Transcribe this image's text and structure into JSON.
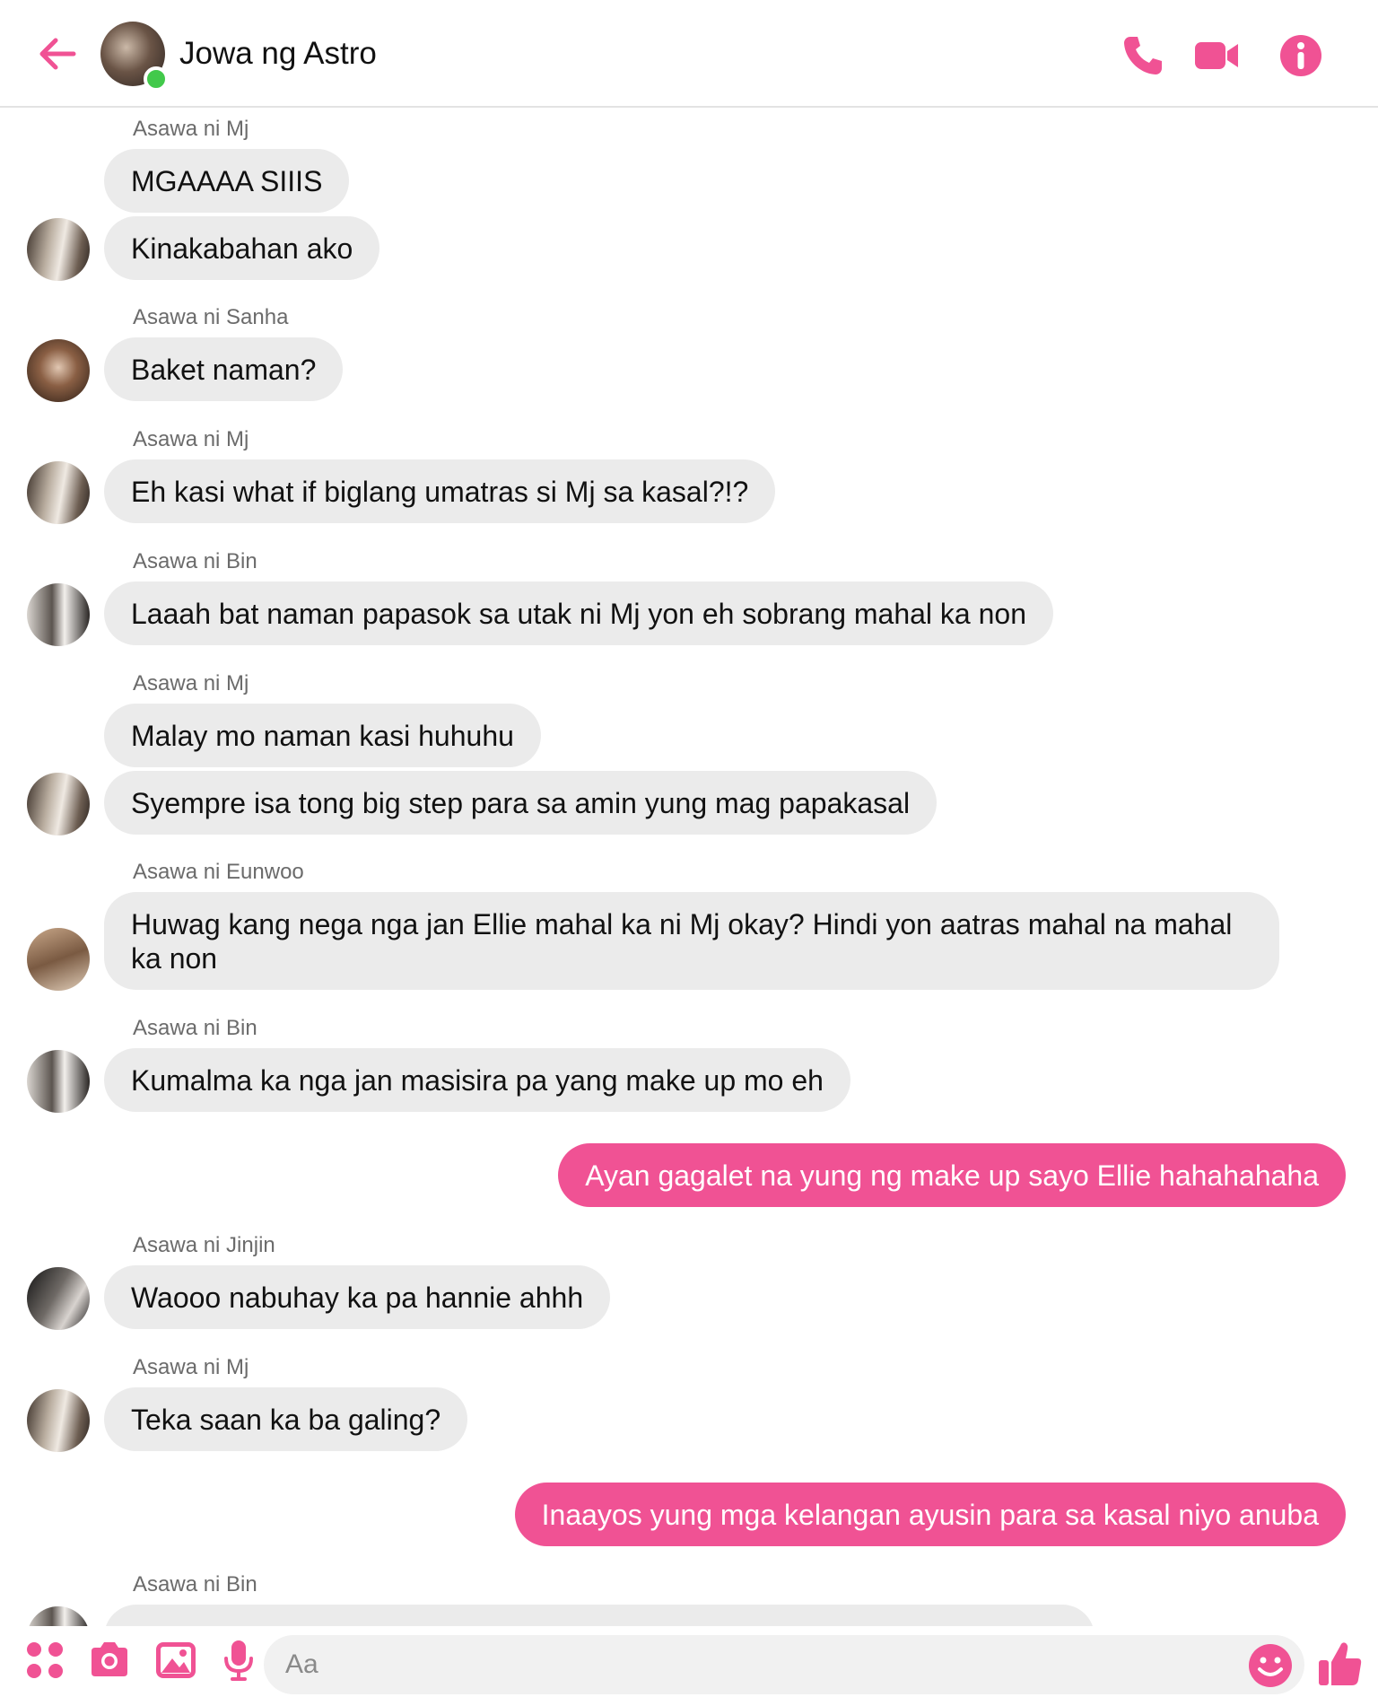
{
  "colors": {
    "accent": "#f05294",
    "incoming_bubble": "#ebebeb",
    "online": "#42c94b"
  },
  "header": {
    "title": "Jowa ng Astro",
    "icons": [
      "back-arrow-icon",
      "phone-icon",
      "video-camera-icon",
      "info-icon"
    ]
  },
  "messages": [
    {
      "sender": "Asawa ni Mj",
      "texts": [
        "MGAAAA SIIIS",
        "Kinakabahan ako"
      ]
    },
    {
      "sender": "Asawa ni Sanha",
      "texts": [
        "Baket naman?"
      ]
    },
    {
      "sender": "Asawa ni Mj",
      "texts": [
        "Eh kasi what if biglang umatras si Mj sa kasal?!?"
      ]
    },
    {
      "sender": "Asawa ni Bin",
      "texts": [
        "Laaah bat naman papasok sa utak ni Mj yon eh sobrang mahal ka non"
      ]
    },
    {
      "sender": "Asawa ni Mj",
      "texts": [
        "Malay mo naman kasi huhuhu",
        "Syempre isa tong big step para sa amin yung mag papakasal"
      ]
    },
    {
      "sender": "Asawa ni Eunwoo",
      "texts": [
        "Huwag kang nega nga jan Ellie mahal ka ni Mj okay? Hindi yon aatras mahal na mahal ka non"
      ]
    },
    {
      "sender": "Asawa ni Bin",
      "texts": [
        "Kumalma ka nga jan masisira pa yang make up mo eh"
      ]
    },
    {
      "sender": "me",
      "texts": [
        "Ayan gagalet na yung ng make up sayo Ellie hahahahaha"
      ]
    },
    {
      "sender": "Asawa ni Jinjin",
      "texts": [
        "Waooo nabuhay ka pa hannie ahhh"
      ]
    },
    {
      "sender": "Asawa ni Mj",
      "texts": [
        "Teka saan ka ba galing?"
      ]
    },
    {
      "sender": "me",
      "texts": [
        "Inaayos yung mga kelangan ayusin para sa kasal niyo anuba"
      ]
    },
    {
      "sender": "Asawa ni Bin",
      "texts": [
        ""
      ]
    }
  ],
  "input": {
    "placeholder": "Aa",
    "icons": [
      "apps-icon",
      "camera-icon",
      "gallery-icon",
      "microphone-icon",
      "emoji-icon",
      "thumbs-up-icon"
    ]
  }
}
